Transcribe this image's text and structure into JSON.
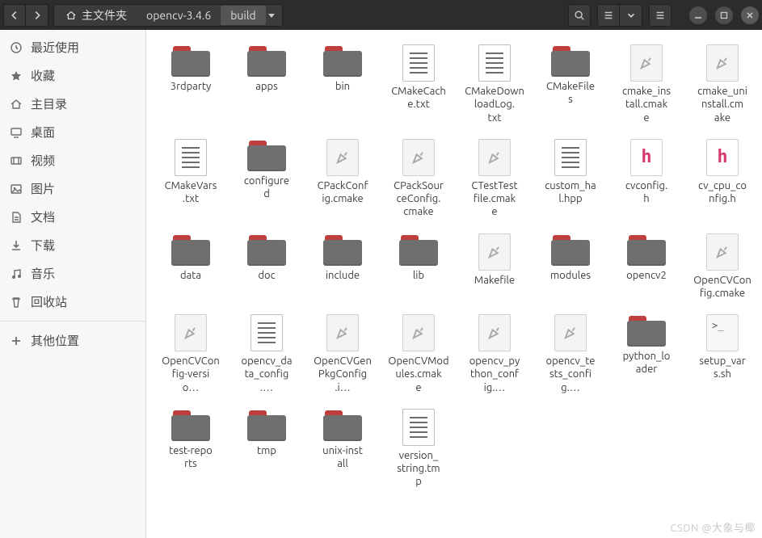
{
  "toolbar": {
    "breadcrumbs": [
      {
        "label": "主文件夹",
        "home": true,
        "active": false
      },
      {
        "label": "opencv-3.4.6",
        "home": false,
        "active": false
      },
      {
        "label": "build",
        "home": false,
        "active": true
      }
    ]
  },
  "sidebar": {
    "items": [
      {
        "icon": "clock",
        "label": "最近使用"
      },
      {
        "icon": "star",
        "label": "收藏"
      },
      {
        "icon": "home",
        "label": "主目录"
      },
      {
        "icon": "desktop",
        "label": "桌面"
      },
      {
        "icon": "video",
        "label": "视频"
      },
      {
        "icon": "image",
        "label": "图片"
      },
      {
        "icon": "document",
        "label": "文档"
      },
      {
        "icon": "download",
        "label": "下载"
      },
      {
        "icon": "music",
        "label": "音乐"
      },
      {
        "icon": "trash",
        "label": "回收站"
      }
    ],
    "other": {
      "icon": "plus",
      "label": "其他位置"
    }
  },
  "files": [
    {
      "type": "folder",
      "label": "3rdparty"
    },
    {
      "type": "folder",
      "label": "apps"
    },
    {
      "type": "folder",
      "label": "bin"
    },
    {
      "type": "text",
      "label": "CMakeCache.txt"
    },
    {
      "type": "text",
      "label": "CMakeDownloadLog.txt"
    },
    {
      "type": "folder",
      "label": "CMakeFiles"
    },
    {
      "type": "cmake",
      "label": "cmake_install.cmake"
    },
    {
      "type": "cmake",
      "label": "cmake_uninstall.cmake"
    },
    {
      "type": "text",
      "label": "CMakeVars.txt"
    },
    {
      "type": "folder",
      "label": "configured"
    },
    {
      "type": "cmake",
      "label": "CPackConfig.cmake"
    },
    {
      "type": "cmake",
      "label": "CPackSourceConfig.cmake"
    },
    {
      "type": "cmake",
      "label": "CTestTestfile.cmake"
    },
    {
      "type": "text",
      "label": "custom_hal.hpp"
    },
    {
      "type": "header",
      "label": "cvconfig.h"
    },
    {
      "type": "header",
      "label": "cv_cpu_config.h"
    },
    {
      "type": "folder",
      "label": "data"
    },
    {
      "type": "folder",
      "label": "doc"
    },
    {
      "type": "folder",
      "label": "include"
    },
    {
      "type": "folder",
      "label": "lib"
    },
    {
      "type": "cmake",
      "label": "Makefile"
    },
    {
      "type": "folder",
      "label": "modules"
    },
    {
      "type": "folder",
      "label": "opencv2"
    },
    {
      "type": "cmake",
      "label": "OpenCVConfig.cmake"
    },
    {
      "type": "cmake",
      "label": "OpenCVConfig-versio…"
    },
    {
      "type": "text",
      "label": "opencv_data_config.…"
    },
    {
      "type": "cmake",
      "label": "OpenCVGenPkgConfig.i…"
    },
    {
      "type": "cmake",
      "label": "OpenCVModules.cmake"
    },
    {
      "type": "cmake",
      "label": "opencv_python_config.…"
    },
    {
      "type": "cmake",
      "label": "opencv_tests_config.…"
    },
    {
      "type": "folder",
      "label": "python_loader"
    },
    {
      "type": "shell",
      "label": "setup_vars.sh"
    },
    {
      "type": "folder",
      "label": "test-reports"
    },
    {
      "type": "folder",
      "label": "tmp"
    },
    {
      "type": "folder",
      "label": "unix-install"
    },
    {
      "type": "text",
      "label": "version_string.tmp"
    }
  ],
  "watermark": "CSDN @大象与椰"
}
